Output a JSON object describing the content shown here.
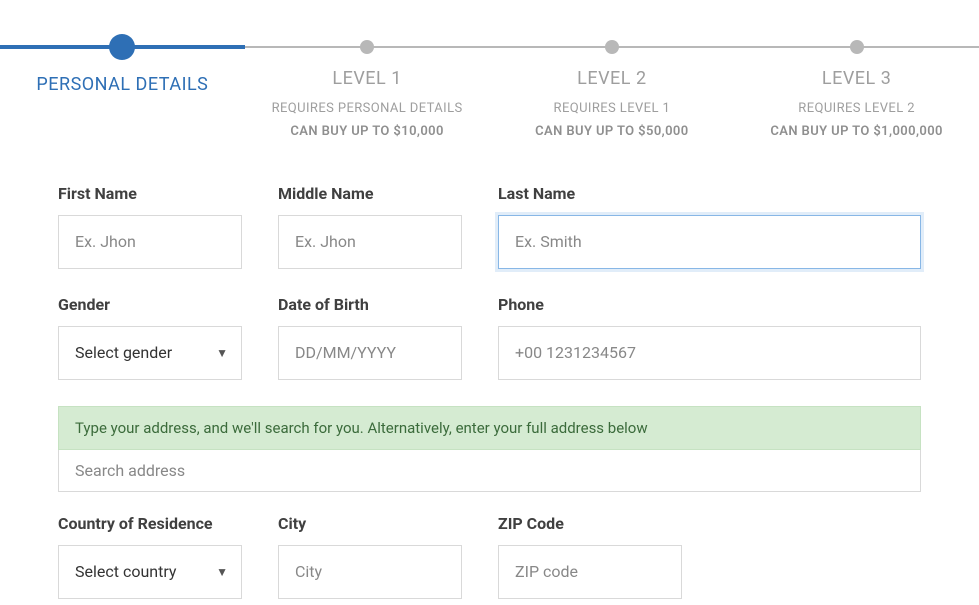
{
  "stepper": {
    "steps": [
      {
        "title": "PERSONAL DETAILS",
        "requires": "",
        "limit": ""
      },
      {
        "title": "LEVEL 1",
        "requires": "REQUIRES PERSONAL DETAILS",
        "limit": "CAN BUY UP TO $10,000"
      },
      {
        "title": "LEVEL 2",
        "requires": "REQUIRES LEVEL 1",
        "limit": "CAN BUY UP TO $50,000"
      },
      {
        "title": "LEVEL 3",
        "requires": "REQUIRES LEVEL 2",
        "limit": "CAN BUY UP TO $1,000,000"
      }
    ]
  },
  "form": {
    "first_name": {
      "label": "First Name",
      "placeholder": "Ex. Jhon",
      "value": ""
    },
    "middle_name": {
      "label": "Middle Name",
      "placeholder": "Ex. Jhon",
      "value": ""
    },
    "last_name": {
      "label": "Last Name",
      "placeholder": "Ex. Smith",
      "value": ""
    },
    "gender": {
      "label": "Gender",
      "selected": "Select gender"
    },
    "dob": {
      "label": "Date of Birth",
      "placeholder": "DD/MM/YYYY",
      "value": ""
    },
    "phone": {
      "label": "Phone",
      "placeholder": "+00 1231234567",
      "value": ""
    },
    "address_hint": "Type your address, and we'll search for you. Alternatively, enter your full address below",
    "address_search": {
      "placeholder": "Search address",
      "value": ""
    },
    "country": {
      "label": "Country of Residence",
      "selected": "Select country"
    },
    "city": {
      "label": "City",
      "placeholder": "City",
      "value": ""
    },
    "zip": {
      "label": "ZIP Code",
      "placeholder": "ZIP code",
      "value": ""
    }
  },
  "colors": {
    "primary": "#2e6fb5",
    "muted": "#9e9e9e",
    "hint_bg": "#d5ebd2"
  }
}
